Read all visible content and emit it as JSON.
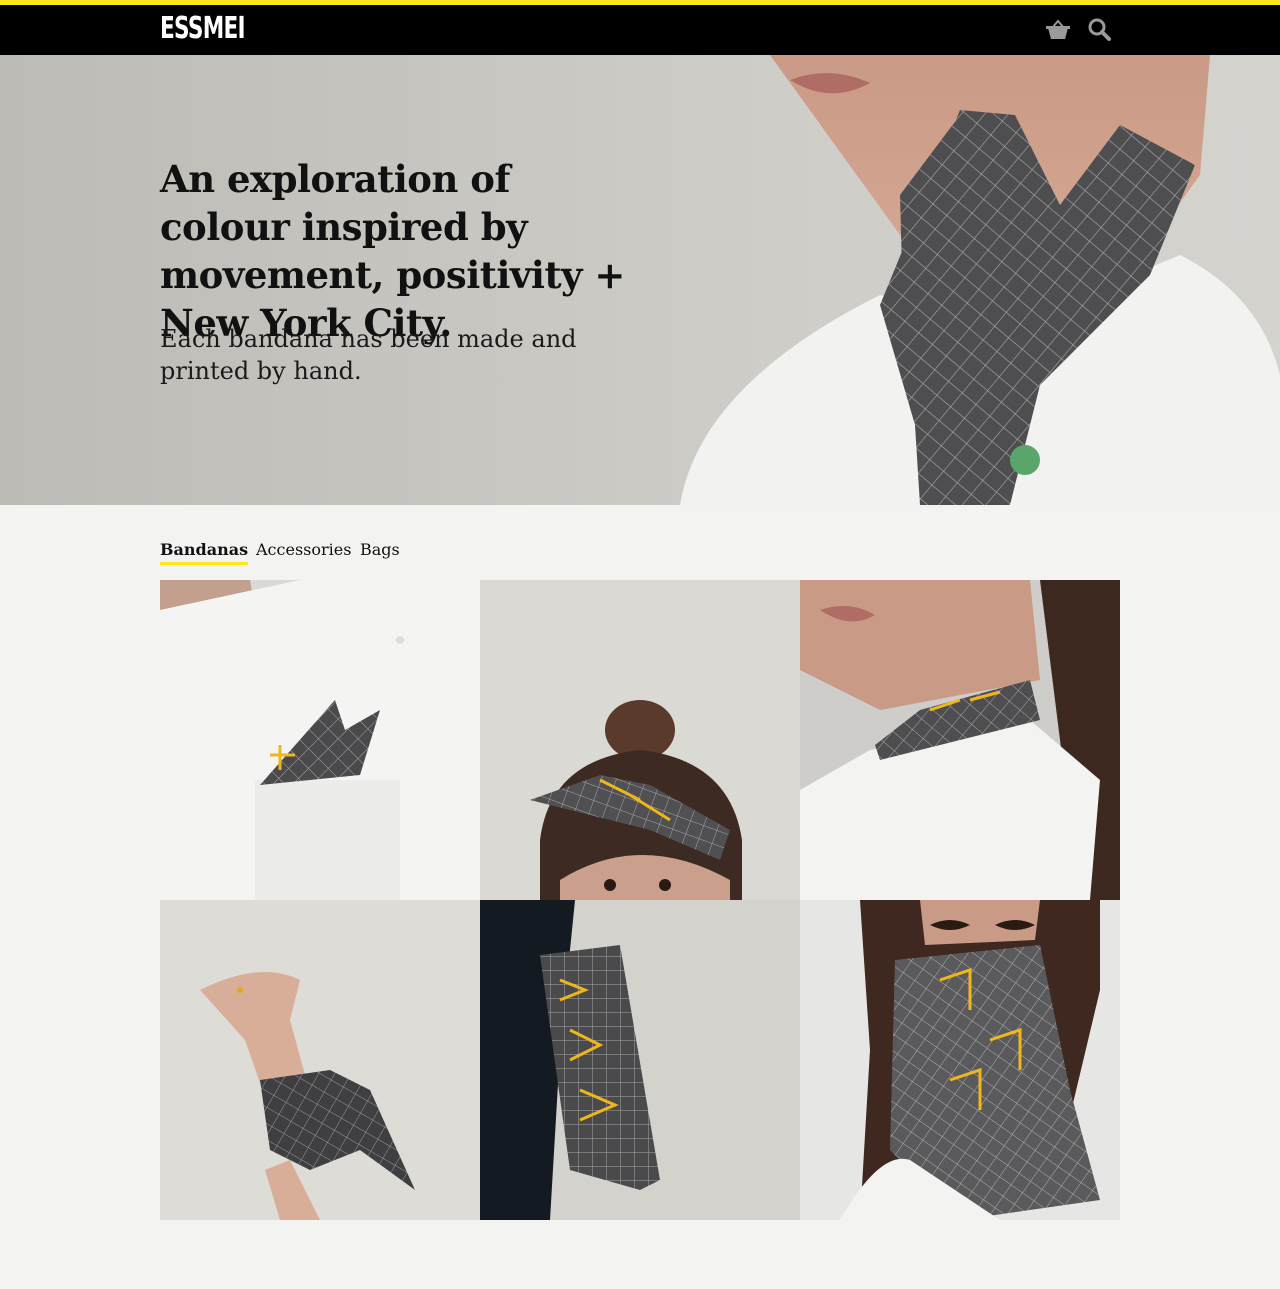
{
  "brand": {
    "name": "ESSMEI",
    "accent_color": "#ffe51c",
    "nav_bg": "#000000"
  },
  "header": {
    "icons": [
      "basket-icon",
      "search-icon"
    ]
  },
  "hero": {
    "headline": "An exploration of colour inspired by movement, positivity + New York City.",
    "subtext": "Each bandana has been made and printed by hand."
  },
  "categories": {
    "tabs": [
      {
        "label": "Bandanas",
        "active": true
      },
      {
        "label": "Accessories",
        "active": false
      },
      {
        "label": "Bags",
        "active": false
      }
    ]
  },
  "products": [
    {
      "image": "bandana-pocket-square-photo"
    },
    {
      "image": "bandana-headband-photo"
    },
    {
      "image": "bandana-neckerchief-photo"
    },
    {
      "image": "bandana-wrist-wrap-photo"
    },
    {
      "image": "bandana-back-pocket-photo"
    },
    {
      "image": "bandana-face-mask-photo"
    }
  ]
}
